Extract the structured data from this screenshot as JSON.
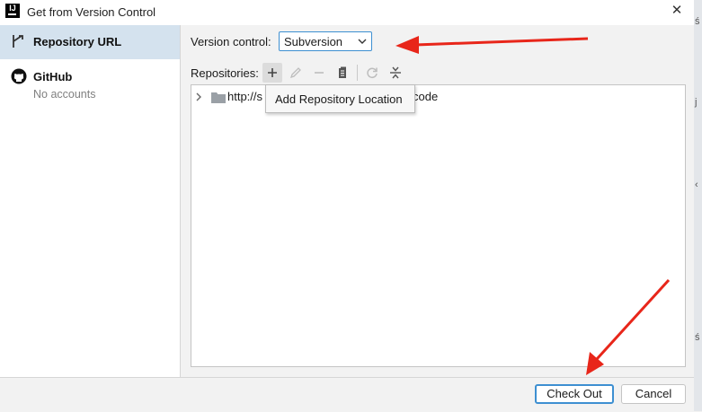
{
  "window": {
    "app_icon_text": "IJ",
    "title": "Get from Version Control"
  },
  "sidebar": {
    "items": [
      {
        "label": "Repository URL",
        "icon": "vcs-arrow-icon",
        "selected": true
      },
      {
        "label": "GitHub",
        "sub": "No accounts",
        "icon": "github-icon",
        "selected": false
      }
    ]
  },
  "version_control": {
    "label": "Version control:",
    "selected": "Subversion"
  },
  "repositories": {
    "label": "Repositories:",
    "toolbar": [
      "add-icon",
      "edit-icon",
      "remove-icon",
      "browse-icon",
      "refresh-icon",
      "collapse-icon"
    ],
    "items": [
      {
        "url_start": "http://s",
        "url_end": "code"
      }
    ]
  },
  "tooltip": {
    "text": "Add Repository Location"
  },
  "buttons": {
    "check_out": "Check Out",
    "cancel": "Cancel"
  },
  "colors": {
    "accent": "#3d8fd1",
    "selection": "#d4e2ee",
    "annotation_arrow": "#e8261a"
  }
}
